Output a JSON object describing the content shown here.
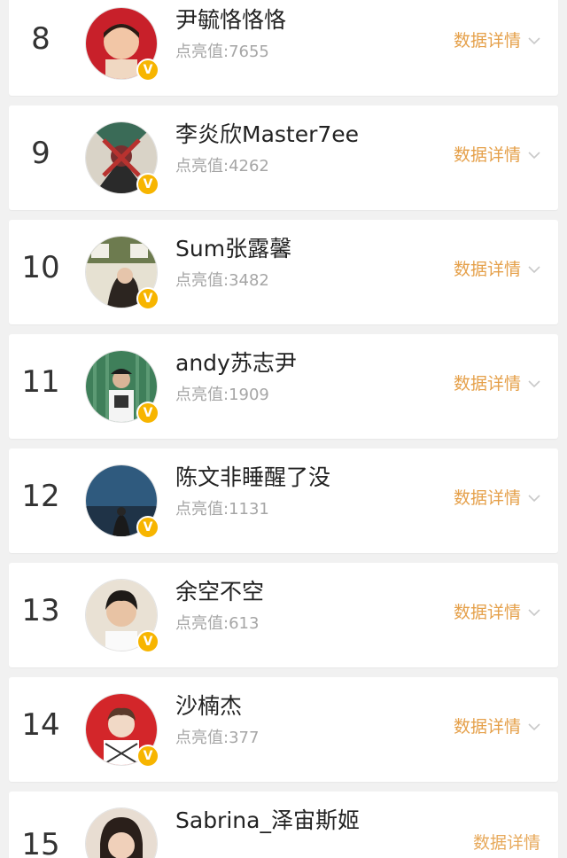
{
  "score_label": "点亮值:",
  "detail_label": "数据详情",
  "verified_badge": "V",
  "colors": {
    "accent": "#e5a04a",
    "badge": "#f7b500",
    "background": "#f1f1f1"
  },
  "rows": [
    {
      "rank": "8",
      "name": "尹毓恪恪恪",
      "score": "点亮值:7655"
    },
    {
      "rank": "9",
      "name": "李炎欣Master7ee",
      "score": "点亮值:4262"
    },
    {
      "rank": "10",
      "name": "Sum张露馨",
      "score": "点亮值:3482"
    },
    {
      "rank": "11",
      "name": "andy苏志尹",
      "score": "点亮值:1909"
    },
    {
      "rank": "12",
      "name": "陈文非睡醒了没",
      "score": "点亮值:1131"
    },
    {
      "rank": "13",
      "name": "余空不空",
      "score": "点亮值:613"
    },
    {
      "rank": "14",
      "name": "沙楠杰",
      "score": "点亮值:377"
    },
    {
      "rank": "15",
      "name": "Sabrina_泽宙斯姬",
      "score": ""
    }
  ]
}
